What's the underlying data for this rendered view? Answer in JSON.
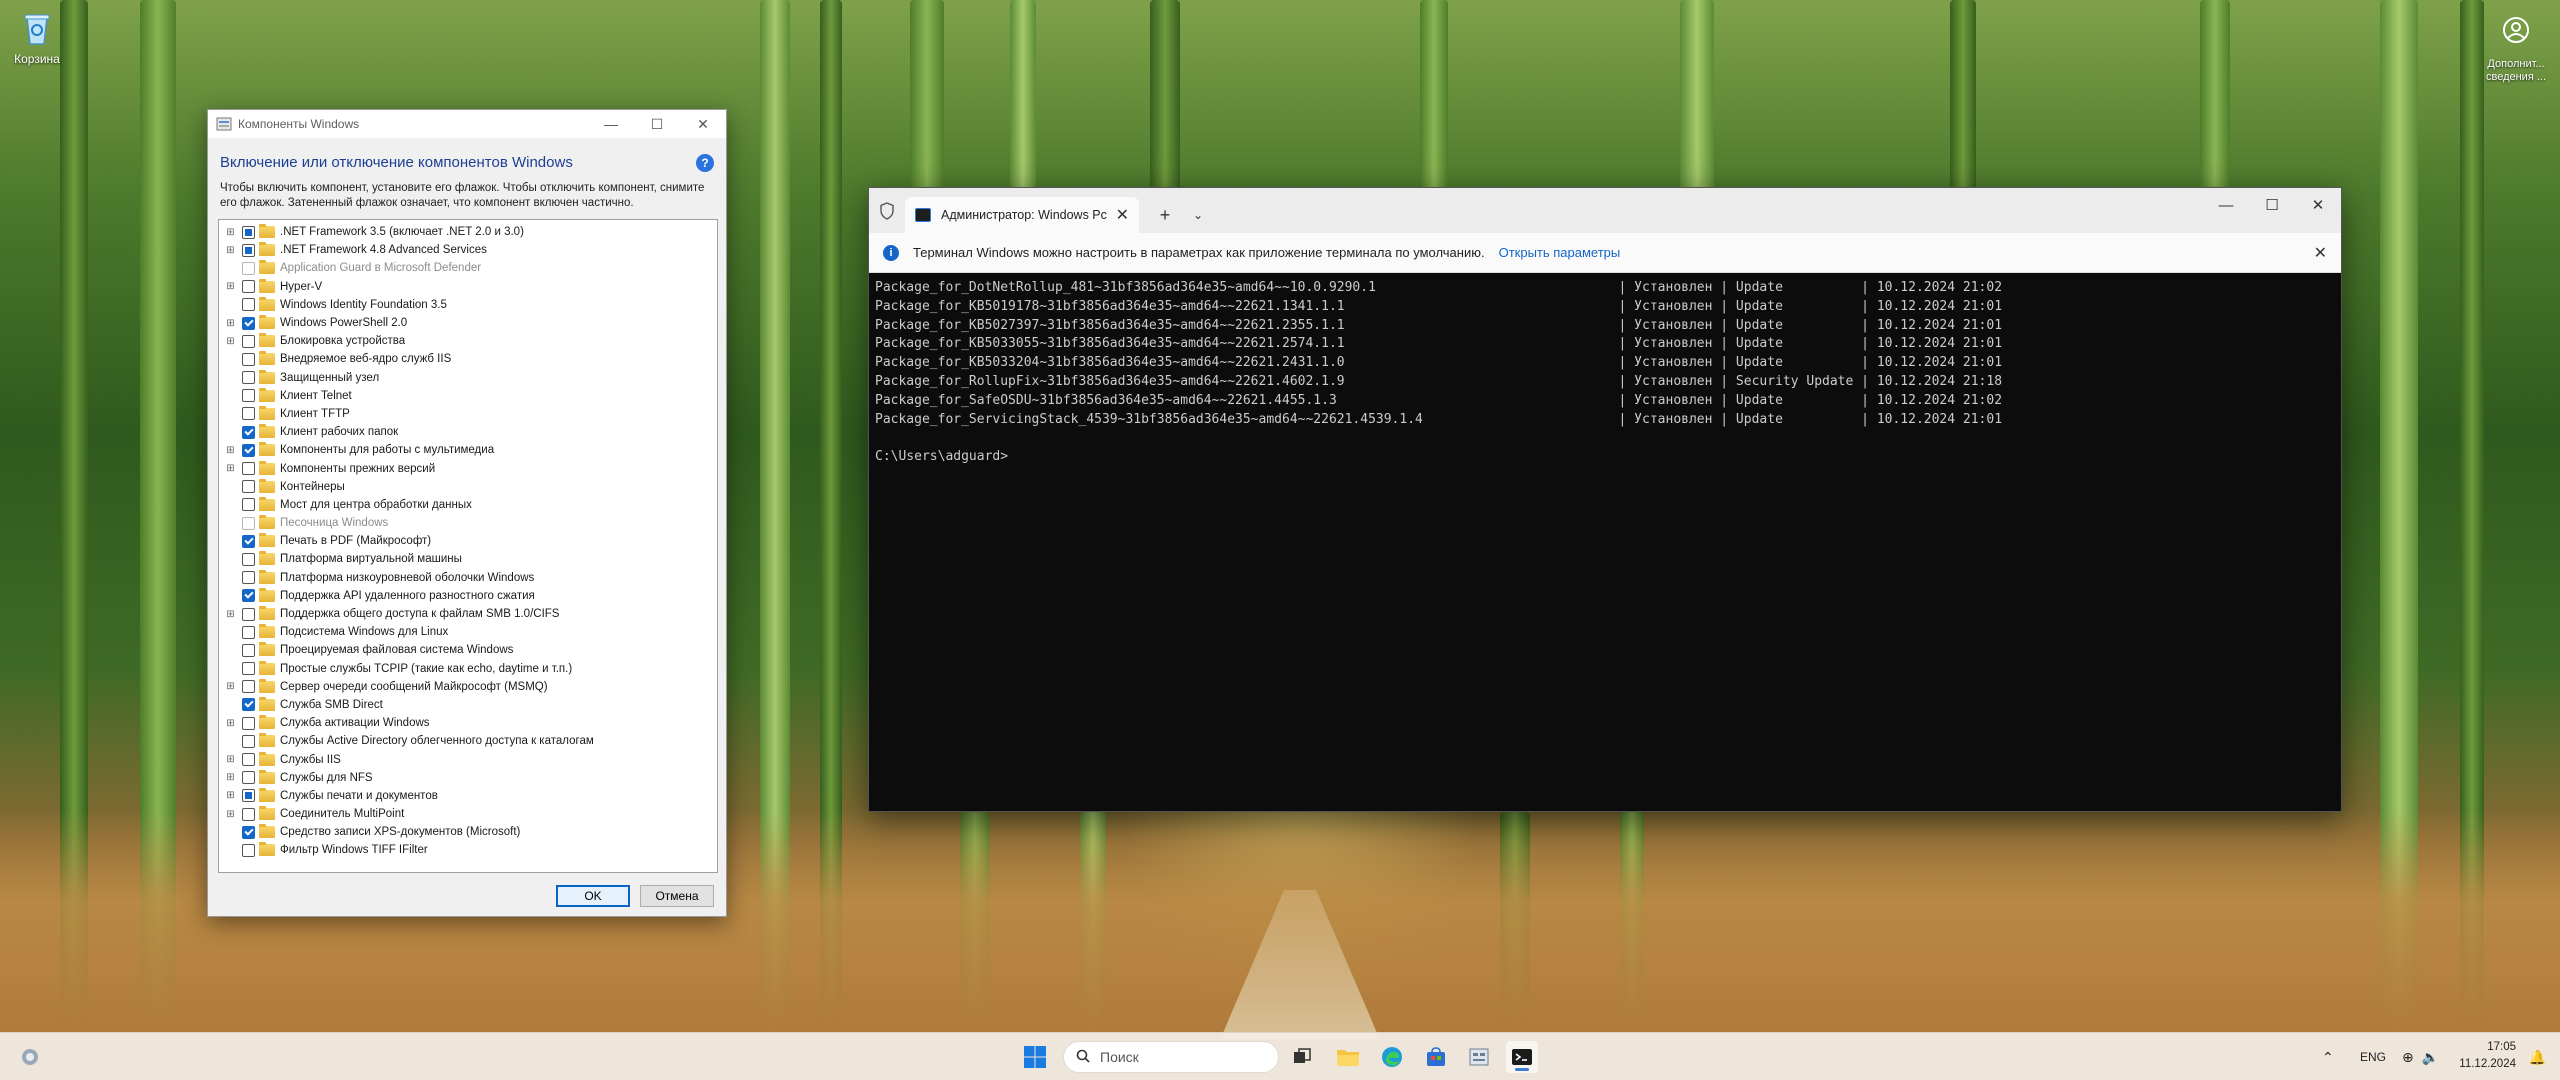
{
  "desktop": {
    "recycle_bin_label": "Корзина",
    "extras_label": "Дополнит... сведения ..."
  },
  "features_dialog": {
    "window_title": "Компоненты Windows",
    "heading": "Включение или отключение компонентов Windows",
    "help_label": "?",
    "description": "Чтобы включить компонент, установите его флажок. Чтобы отключить компонент, снимите его флажок. Затененный флажок означает, что компонент включен частично.",
    "items": [
      {
        "label": ".NET Framework 3.5 (включает .NET 2.0 и 3.0)",
        "expand": true,
        "state": "partial"
      },
      {
        "label": ".NET Framework 4.8 Advanced Services",
        "expand": true,
        "state": "partial"
      },
      {
        "label": "Application Guard в Microsoft Defender",
        "expand": false,
        "state": "disabled"
      },
      {
        "label": "Hyper-V",
        "expand": true,
        "state": "unchecked"
      },
      {
        "label": "Windows Identity Foundation 3.5",
        "expand": false,
        "state": "unchecked"
      },
      {
        "label": "Windows PowerShell 2.0",
        "expand": true,
        "state": "checked"
      },
      {
        "label": "Блокировка устройства",
        "expand": true,
        "state": "unchecked"
      },
      {
        "label": "Внедряемое веб-ядро служб IIS",
        "expand": false,
        "state": "unchecked"
      },
      {
        "label": "Защищенный узел",
        "expand": false,
        "state": "unchecked"
      },
      {
        "label": "Клиент Telnet",
        "expand": false,
        "state": "unchecked"
      },
      {
        "label": "Клиент TFTP",
        "expand": false,
        "state": "unchecked"
      },
      {
        "label": "Клиент рабочих папок",
        "expand": false,
        "state": "checked"
      },
      {
        "label": "Компоненты для работы с мультимедиа",
        "expand": true,
        "state": "checked"
      },
      {
        "label": "Компоненты прежних версий",
        "expand": true,
        "state": "unchecked"
      },
      {
        "label": "Контейнеры",
        "expand": false,
        "state": "unchecked"
      },
      {
        "label": "Мост для центра обработки данных",
        "expand": false,
        "state": "unchecked"
      },
      {
        "label": "Песочница Windows",
        "expand": false,
        "state": "disabled"
      },
      {
        "label": "Печать в PDF (Майкрософт)",
        "expand": false,
        "state": "checked"
      },
      {
        "label": "Платформа виртуальной машины",
        "expand": false,
        "state": "unchecked"
      },
      {
        "label": "Платформа низкоуровневой оболочки Windows",
        "expand": false,
        "state": "unchecked"
      },
      {
        "label": "Поддержка API удаленного разностного сжатия",
        "expand": false,
        "state": "checked"
      },
      {
        "label": "Поддержка общего доступа к файлам SMB 1.0/CIFS",
        "expand": true,
        "state": "unchecked"
      },
      {
        "label": "Подсистема Windows для Linux",
        "expand": false,
        "state": "unchecked"
      },
      {
        "label": "Проецируемая файловая система Windows",
        "expand": false,
        "state": "unchecked"
      },
      {
        "label": "Простые службы TCPIP (такие как echo, daytime и т.п.)",
        "expand": false,
        "state": "unchecked"
      },
      {
        "label": "Сервер очереди сообщений Майкрософт (MSMQ)",
        "expand": true,
        "state": "unchecked"
      },
      {
        "label": "Служба SMB Direct",
        "expand": false,
        "state": "checked"
      },
      {
        "label": "Служба активации Windows",
        "expand": true,
        "state": "unchecked"
      },
      {
        "label": "Службы Active Directory облегченного доступа к каталогам",
        "expand": false,
        "state": "unchecked"
      },
      {
        "label": "Службы IIS",
        "expand": true,
        "state": "unchecked"
      },
      {
        "label": "Службы для NFS",
        "expand": true,
        "state": "unchecked"
      },
      {
        "label": "Службы печати и документов",
        "expand": true,
        "state": "partial"
      },
      {
        "label": "Соединитель MultiPoint",
        "expand": true,
        "state": "unchecked"
      },
      {
        "label": "Средство записи XPS-документов (Microsoft)",
        "expand": false,
        "state": "checked"
      },
      {
        "label": "Фильтр Windows TIFF IFilter",
        "expand": false,
        "state": "unchecked"
      }
    ],
    "ok_label": "OK",
    "cancel_label": "Отмена"
  },
  "terminal": {
    "tab_title": "Администратор: Windows Pc",
    "info_text": "Терминал Windows можно настроить в параметрах как приложение терминала по умолчанию.",
    "info_link": "Открыть параметры",
    "lines": [
      "Package_for_DotNetRollup_481~31bf3856ad364e35~amd64~~10.0.9290.1                               | Установлен | Update          | 10.12.2024 21:02",
      "Package_for_KB5019178~31bf3856ad364e35~amd64~~22621.1341.1.1                                   | Установлен | Update          | 10.12.2024 21:01",
      "Package_for_KB5027397~31bf3856ad364e35~amd64~~22621.2355.1.1                                   | Установлен | Update          | 10.12.2024 21:01",
      "Package_for_KB5033055~31bf3856ad364e35~amd64~~22621.2574.1.1                                   | Установлен | Update          | 10.12.2024 21:01",
      "Package_for_KB5033204~31bf3856ad364e35~amd64~~22621.2431.1.0                                   | Установлен | Update          | 10.12.2024 21:01",
      "Package_for_RollupFix~31bf3856ad364e35~amd64~~22621.4602.1.9                                   | Установлен | Security Update | 10.12.2024 21:18",
      "Package_for_SafeOSDU~31bf3856ad364e35~amd64~~22621.4455.1.3                                    | Установлен | Update          | 10.12.2024 21:02",
      "Package_for_ServicingStack_4539~31bf3856ad364e35~amd64~~22621.4539.1.4                         | Установлен | Update          | 10.12.2024 21:01",
      "",
      "C:\\Users\\adguard>"
    ]
  },
  "taskbar": {
    "search_placeholder": "Поиск",
    "lang": "ENG",
    "time": "17:05",
    "date": "11.12.2024"
  },
  "colors": {
    "accent": "#1466c8",
    "terminal_bg": "#0c0c0c",
    "dialog_heading": "#1c3f94"
  }
}
